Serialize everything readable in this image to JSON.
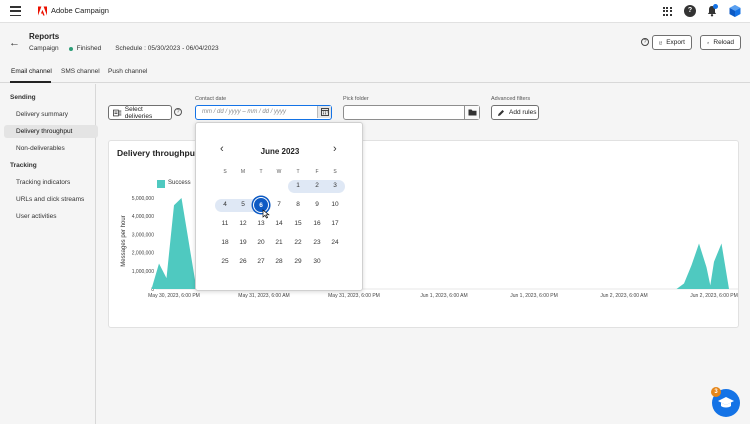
{
  "topbar": {
    "app_name": "Adobe Campaign",
    "help_glyph": "?"
  },
  "header": {
    "title": "Reports",
    "type": "Campaign",
    "status": "Finished",
    "schedule": "Schedule : 05/30/2023 - 06/04/2023",
    "export_label": "Export",
    "reload_label": "Reload",
    "info_glyph": "?"
  },
  "tabs": [
    {
      "label": "Email channel"
    },
    {
      "label": "SMS channel"
    },
    {
      "label": "Push channel"
    }
  ],
  "sidebar": {
    "sending_heading": "Sending",
    "sending_items": [
      {
        "label": "Delivery summary"
      },
      {
        "label": "Delivery throughput"
      },
      {
        "label": "Non-deliverables"
      }
    ],
    "tracking_heading": "Tracking",
    "tracking_items": [
      {
        "label": "Tracking indicators"
      },
      {
        "label": "URLs and click streams"
      },
      {
        "label": "User activities"
      }
    ]
  },
  "filters": {
    "select_deliveries_label": "Select deliveries",
    "help_glyph": "?",
    "contact_date_label": "Contact date",
    "date_placeholder": "mm / dd / yyyy   –   mm / dd / yyyy",
    "pick_folder_label": "Pick folder",
    "advanced_filters_label": "Advanced filters",
    "add_rules_label": "Add rules"
  },
  "calendar": {
    "month": "June 2023",
    "prev_glyph": "‹",
    "next_glyph": "›",
    "weekdays": [
      "S",
      "M",
      "T",
      "W",
      "T",
      "F",
      "S"
    ],
    "weeks": [
      [
        "",
        "",
        "",
        "",
        "1",
        "2",
        "3"
      ],
      [
        "4",
        "5",
        "6",
        "7",
        "8",
        "9",
        "10"
      ],
      [
        "11",
        "12",
        "13",
        "14",
        "15",
        "16",
        "17"
      ],
      [
        "18",
        "19",
        "20",
        "21",
        "22",
        "23",
        "24"
      ],
      [
        "25",
        "26",
        "27",
        "28",
        "29",
        "30",
        ""
      ]
    ],
    "selected_day": "6"
  },
  "chart": {
    "title": "Delivery throughput",
    "legend": "Success",
    "y_title": "Messages per hour",
    "y_ticks": [
      "5,000,000",
      "4,000,000",
      "3,000,000",
      "2,000,000",
      "1,000,000",
      "0"
    ],
    "x_ticks": [
      "May 30, 2023, 6:00 PM",
      "May 31, 2023, 6:00 AM",
      "May 31, 2023, 6:00 PM",
      "Jun 1, 2023, 6:00 AM",
      "Jun 1, 2023, 6:00 PM",
      "Jun 2, 2023, 6:00 AM",
      "Jun 2, 2023, 6:00 PM"
    ],
    "color": "#4fc9c0"
  },
  "chart_data": {
    "type": "area",
    "xlabel": "",
    "ylabel": "Messages per hour",
    "ylim": [
      0,
      5000000
    ],
    "x_tick_labels": [
      "May 30, 2023, 6:00 PM",
      "May 31, 2023, 6:00 AM",
      "May 31, 2023, 6:00 PM",
      "Jun 1, 2023, 6:00 AM",
      "Jun 1, 2023, 6:00 PM",
      "Jun 2, 2023, 6:00 AM",
      "Jun 2, 2023, 6:00 PM"
    ],
    "series": [
      {
        "name": "Success",
        "points": [
          [
            "May 30, 2023, 3:00 PM",
            0
          ],
          [
            "May 30, 2023, 4:00 PM",
            1400000
          ],
          [
            "May 30, 2023, 5:00 PM",
            600000
          ],
          [
            "May 30, 2023, 6:00 PM",
            4600000
          ],
          [
            "May 30, 2023, 7:00 PM",
            5000000
          ],
          [
            "May 30, 2023, 9:00 PM",
            0
          ],
          [
            "Jun 2, 2023, 1:00 PM",
            0
          ],
          [
            "Jun 2, 2023, 2:00 PM",
            300000
          ],
          [
            "Jun 2, 2023, 3:00 PM",
            1300000
          ],
          [
            "Jun 2, 2023, 4:00 PM",
            2500000
          ],
          [
            "Jun 2, 2023, 5:00 PM",
            1200000
          ],
          [
            "Jun 2, 2023, 5:30 PM",
            200000
          ],
          [
            "Jun 2, 2023, 6:00 PM",
            1500000
          ],
          [
            "Jun 2, 2023, 7:00 PM",
            2500000
          ],
          [
            "Jun 2, 2023, 8:00 PM",
            0
          ]
        ]
      }
    ]
  },
  "fab": {
    "badge": "3"
  }
}
